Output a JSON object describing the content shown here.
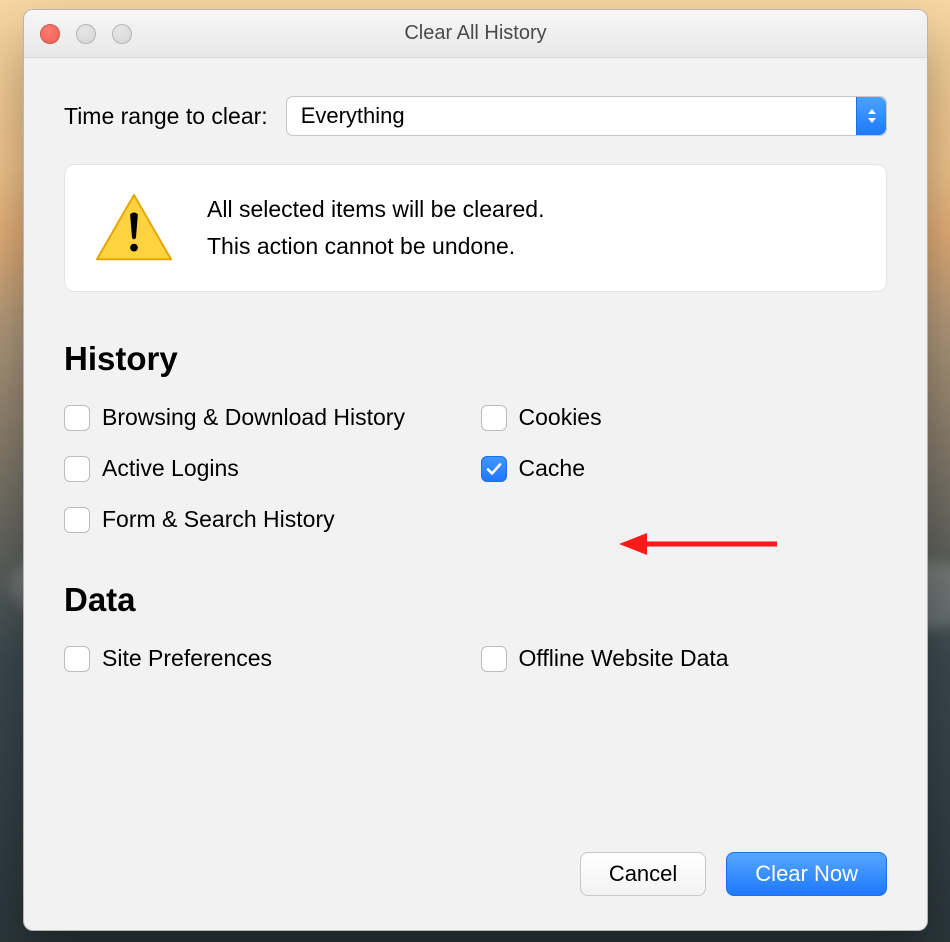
{
  "title": "Clear All History",
  "range": {
    "label": "Time range to clear:",
    "value": "Everything"
  },
  "warning": {
    "line1": "All selected items will be cleared.",
    "line2": "This action cannot be undone."
  },
  "sections": {
    "history": {
      "heading": "History",
      "items": [
        {
          "label": "Browsing & Download History",
          "checked": false
        },
        {
          "label": "Cookies",
          "checked": false
        },
        {
          "label": "Active Logins",
          "checked": false
        },
        {
          "label": "Cache",
          "checked": true
        },
        {
          "label": "Form & Search History",
          "checked": false
        }
      ]
    },
    "data": {
      "heading": "Data",
      "items": [
        {
          "label": "Site Preferences",
          "checked": false
        },
        {
          "label": "Offline Website Data",
          "checked": false
        }
      ]
    }
  },
  "buttons": {
    "cancel": "Cancel",
    "clear": "Clear Now"
  }
}
